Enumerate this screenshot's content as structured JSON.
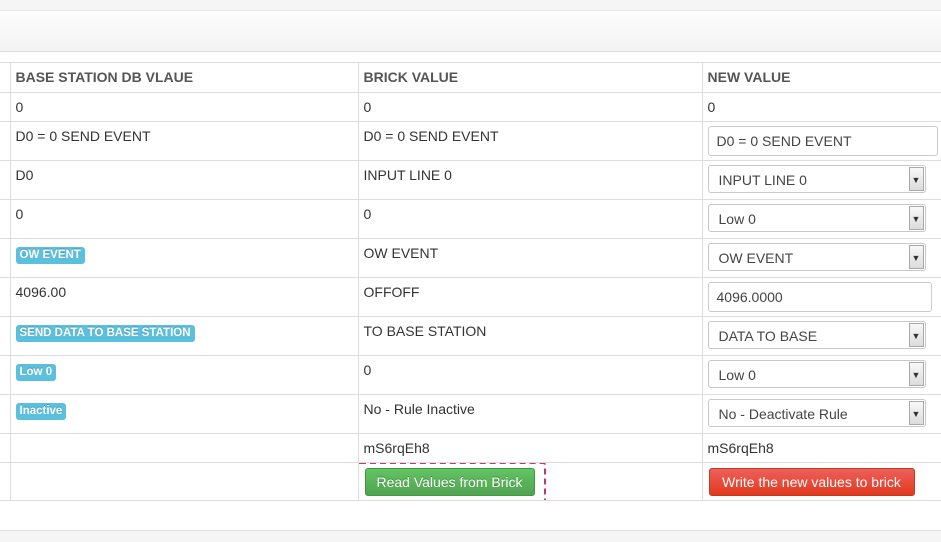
{
  "table": {
    "headers": [
      "BASE STATION DB VLAUE",
      "BRICK VALUE",
      "NEW VALUE"
    ],
    "rows": [
      {
        "db": "0",
        "brick": "0",
        "new": "0"
      },
      {
        "db": "D0 = 0 SEND EVENT",
        "brick": "D0 = 0 SEND EVENT",
        "new": "D0 = 0 SEND EVENT"
      },
      {
        "db": "D0",
        "brick": "INPUT LINE 0",
        "new": "INPUT LINE 0"
      },
      {
        "db": "0",
        "brick": "0",
        "new": "Low 0"
      },
      {
        "db": "OW EVENT",
        "brick": "OW EVENT",
        "new": "OW EVENT"
      },
      {
        "db": "4096.00",
        "brick": "OFFOFF",
        "new": "4096.0000"
      },
      {
        "db": "SEND DATA TO BASE STATION",
        "brick": "TO BASE STATION",
        "new": "DATA TO BASE"
      },
      {
        "db": "Low 0",
        "brick": "0",
        "new": "Low 0"
      },
      {
        "db": "Inactive",
        "brick": "No - Rule Inactive",
        "new": "No - Deactivate Rule"
      },
      {
        "db": "",
        "brick": "mS6rqEh8",
        "new": "mS6rqEh8"
      }
    ]
  },
  "actions": {
    "read_label": "Read Values from Brick",
    "write_label": "Write the new values to brick"
  },
  "icons": {
    "select_arrow": "chevron-down-icon"
  },
  "colors": {
    "label_info": "#5bc0de",
    "read_button": "#5bb75b",
    "write_button": "#e8452a",
    "highlight": "#c0396b"
  }
}
